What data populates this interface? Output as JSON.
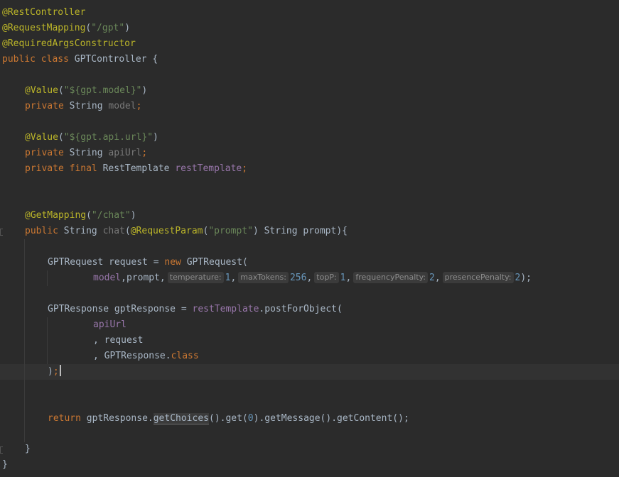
{
  "code": {
    "l1_annotation": "@RestController",
    "l2_annotation": "@RequestMapping",
    "l2_open": "(",
    "l2_string": "\"/gpt\"",
    "l2_close": ")",
    "l3_annotation": "@RequiredArgsConstructor",
    "l4_public": "public ",
    "l4_class": "class ",
    "l4_name": "GPTController {",
    "l5_annotation": "@Value",
    "l5_open": "(",
    "l5_string": "\"${gpt.model}\"",
    "l5_close": ")",
    "l6_private": "private ",
    "l6_type": "String ",
    "l6_field": "model",
    "l6_semi": ";",
    "l7_annotation": "@Value",
    "l7_open": "(",
    "l7_string": "\"${gpt.api.url}\"",
    "l7_close": ")",
    "l8_private": "private ",
    "l8_type": "String ",
    "l8_field": "apiUrl",
    "l8_semi": ";",
    "l9_private": "private ",
    "l9_final": "final ",
    "l9_type": "RestTemplate ",
    "l9_field": "restTemplate",
    "l9_semi": ";",
    "l10_annotation": "@GetMapping",
    "l10_open": "(",
    "l10_string": "\"/chat\"",
    "l10_close": ")",
    "l11_public": "public ",
    "l11_type": "String ",
    "l11_method": "chat",
    "l11_paren": "(",
    "l11_annotation": "@RequestParam",
    "l11_ann_open": "(",
    "l11_string": "\"prompt\"",
    "l11_rest": ") String prompt){",
    "l12_decl": "GPTRequest request = ",
    "l12_new": "new ",
    "l12_ctor": "GPTRequest(",
    "l13_model": "model",
    "l13_prompt": ",prompt,",
    "hint_temperature": "temperature:",
    "val_temperature": "1",
    "sep1": ",",
    "hint_maxTokens": "maxTokens:",
    "val_maxTokens": "256",
    "sep2": ",",
    "hint_topP": "topP:",
    "val_topP": "1",
    "sep3": ",",
    "hint_frequencyPenalty": "frequencyPenalty:",
    "val_frequencyPenalty": "2",
    "sep4": ",",
    "hint_presencePenalty": "presencePenalty:",
    "val_presencePenalty": "2",
    "l13_end": ");",
    "l14_decl": "GPTResponse gptResponse = ",
    "l14_field": "restTemplate",
    "l14_call": ".postForObject(",
    "l15_arg": "apiUrl",
    "l16_arg": ", request",
    "l17_arg": ", GPTResponse.",
    "l17_class": "class",
    "l18_paren": ")",
    "l18_semi": ";",
    "l19_return": "return ",
    "l19_obj": "gptResponse.",
    "l19_method": "getChoices",
    "l19_get": "().get(",
    "l19_num": "0",
    "l19_rest": ").getMessage().getContent();",
    "l20_close": "}",
    "l21_close": "}"
  }
}
